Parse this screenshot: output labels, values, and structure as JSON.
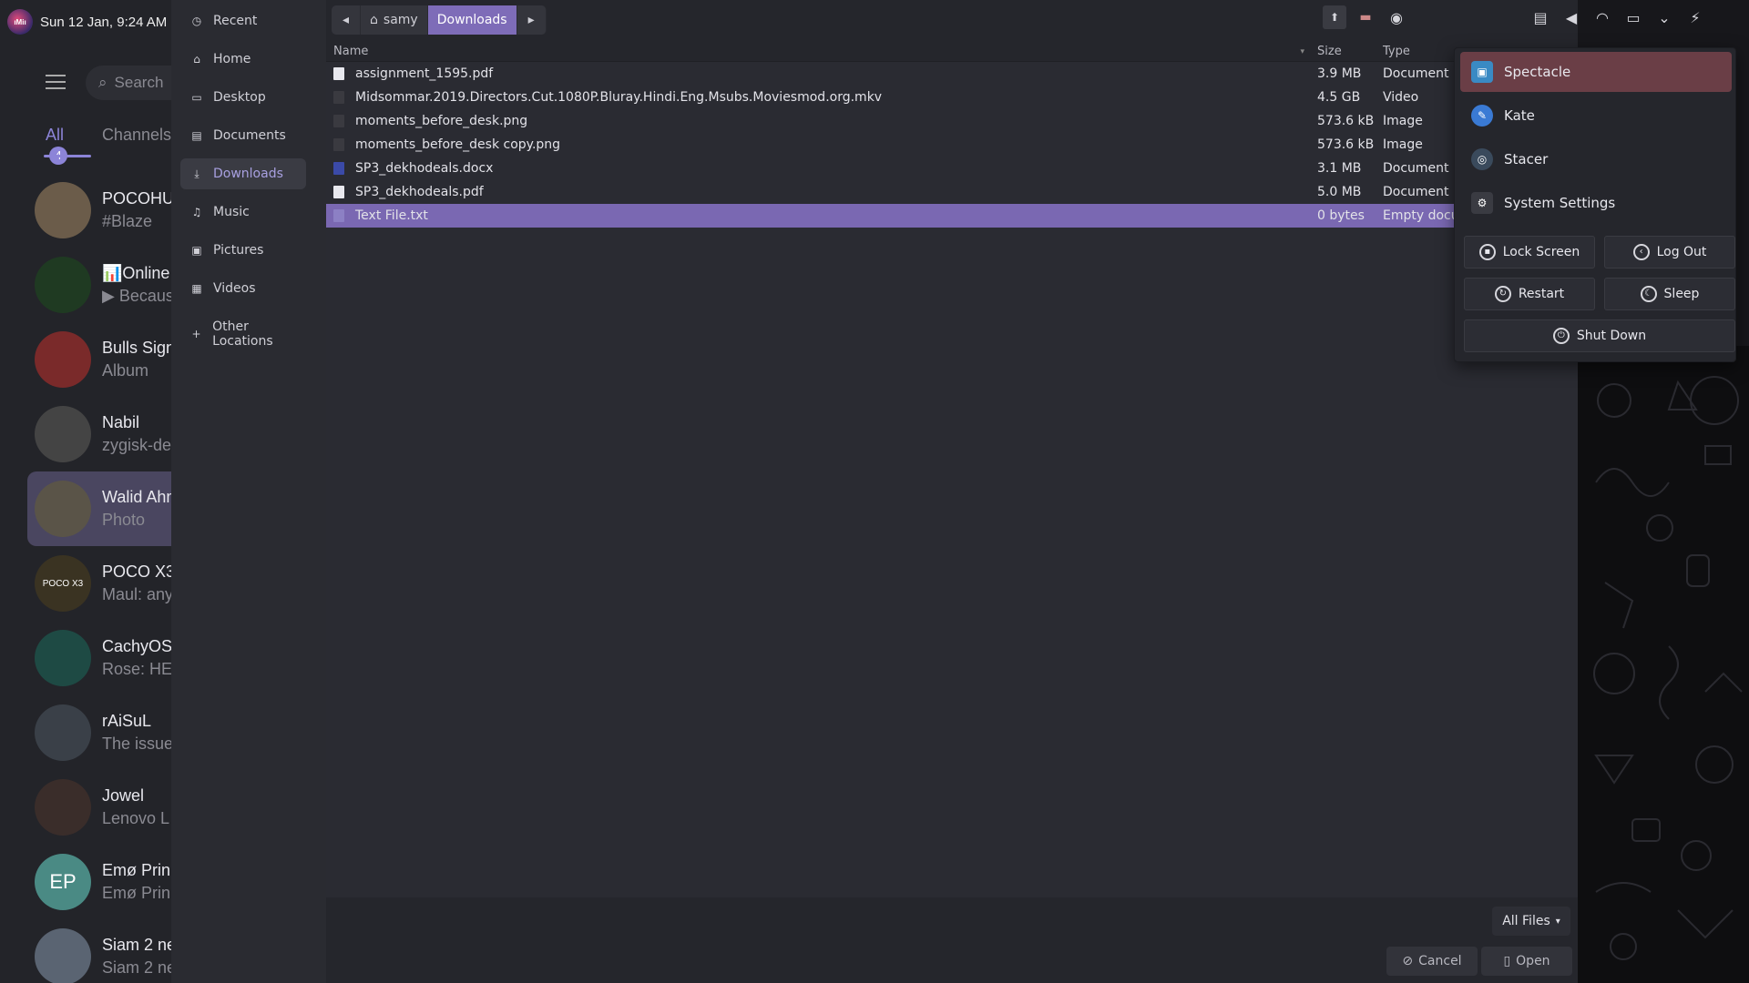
{
  "topbar": {
    "datetime": "Sun 12 Jan, 9:24 AM",
    "logo_text": "ıMiı"
  },
  "chat": {
    "search_placeholder": "Search",
    "tabs": [
      {
        "label": "All",
        "badge": "4"
      },
      {
        "label": "Channels"
      }
    ],
    "items": [
      {
        "name": "POCOHUB",
        "preview": "#Blaze",
        "avatar_color": "#6b5c4a",
        "avatar_text": ""
      },
      {
        "name": "📊Online",
        "preview": "▶ Because",
        "avatar_color": "#1f3a22",
        "avatar_text": ""
      },
      {
        "name": "Bulls Signal",
        "preview": "Album",
        "avatar_color": "#7a2a2a",
        "avatar_text": ""
      },
      {
        "name": "Nabil",
        "preview": "zygisk-de",
        "avatar_color": "#444",
        "avatar_text": ""
      },
      {
        "name": "Walid Ahmed",
        "preview": "Photo",
        "avatar_color": "#5a5448",
        "avatar_text": ""
      },
      {
        "name": "POCO X3",
        "preview": "Maul: any",
        "avatar_color": "#3a3322",
        "avatar_text": "POCO X3"
      },
      {
        "name": "CachyOS",
        "preview": "Rose: HE",
        "avatar_color": "#1e4a44",
        "avatar_text": ""
      },
      {
        "name": "rAiSuL",
        "preview": "The issue",
        "avatar_color": "#3a4048",
        "avatar_text": ""
      },
      {
        "name": "Jowel",
        "preview": "Lenovo L",
        "avatar_color": "#3a2d2a",
        "avatar_text": ""
      },
      {
        "name": "Emø Prin",
        "preview": "Emø Prin",
        "avatar_color": "#4a8a84",
        "avatar_text": "EP"
      },
      {
        "name": "Siam 2 ne",
        "preview": "Siam 2 ne",
        "avatar_color": "#5a6472",
        "avatar_text": ""
      }
    ]
  },
  "places": [
    {
      "label": "Recent",
      "icon": "clock-icon",
      "glyph": "◷"
    },
    {
      "label": "Home",
      "icon": "home-icon",
      "glyph": "⌂"
    },
    {
      "label": "Desktop",
      "icon": "desktop-icon",
      "glyph": "▭"
    },
    {
      "label": "Documents",
      "icon": "documents-icon",
      "glyph": "▤"
    },
    {
      "label": "Downloads",
      "icon": "downloads-icon",
      "glyph": "⤓"
    },
    {
      "label": "Music",
      "icon": "music-icon",
      "glyph": "♫"
    },
    {
      "label": "Pictures",
      "icon": "pictures-icon",
      "glyph": "▣"
    },
    {
      "label": "Videos",
      "icon": "videos-icon",
      "glyph": "▦"
    },
    {
      "label": "Other Locations",
      "icon": "plus-icon",
      "glyph": "+"
    }
  ],
  "path": {
    "home_label": "samy",
    "current_label": "Downloads"
  },
  "columns": {
    "name": "Name",
    "size": "Size",
    "type": "Type"
  },
  "files": [
    {
      "name": "assignment_1595.pdf",
      "size": "3.9 MB",
      "type": "Document",
      "icon_color": "#e8e8ee"
    },
    {
      "name": "Midsommar.2019.Directors.Cut.1080P.Bluray.Hindi.Eng.Msubs.Moviesmod.org.mkv",
      "size": "4.5 GB",
      "type": "Video",
      "icon_color": "#3a3a40"
    },
    {
      "name": "moments_before_desk.png",
      "size": "573.6 kB",
      "type": "Image",
      "icon_color": "#3a3a40"
    },
    {
      "name": "moments_before_desk copy.png",
      "size": "573.6 kB",
      "type": "Image",
      "icon_color": "#3a3a40"
    },
    {
      "name": "SP3_dekhodeals.docx",
      "size": "3.1 MB",
      "type": "Document",
      "icon_color": "#3b4aa8"
    },
    {
      "name": "SP3_dekhodeals.pdf",
      "size": "5.0 MB",
      "type": "Document",
      "icon_color": "#e8e8ee"
    },
    {
      "name": "Text File.txt",
      "size": "0 bytes",
      "type": "Empty document",
      "icon_color": "#8c80c4"
    }
  ],
  "footer": {
    "filter_label": "All Files",
    "cancel_label": "Cancel",
    "open_label": "Open"
  },
  "popup": {
    "apps": [
      {
        "label": "Spectacle",
        "icon": "spectacle-icon",
        "color": "#3a8ac4"
      },
      {
        "label": "Kate",
        "icon": "kate-icon",
        "color": "#3a7ad4"
      },
      {
        "label": "Stacer",
        "icon": "stacer-icon",
        "color": "#3a4a5c"
      },
      {
        "label": "System Settings",
        "icon": "settings-icon",
        "color": "#3a3b42"
      }
    ],
    "actions": {
      "lock": "Lock Screen",
      "logout": "Log Out",
      "restart": "Restart",
      "sleep": "Sleep",
      "shutdown": "Shut Down"
    }
  },
  "colors": {
    "accent": "#7a68b2",
    "highlight": "#6a3e46"
  }
}
